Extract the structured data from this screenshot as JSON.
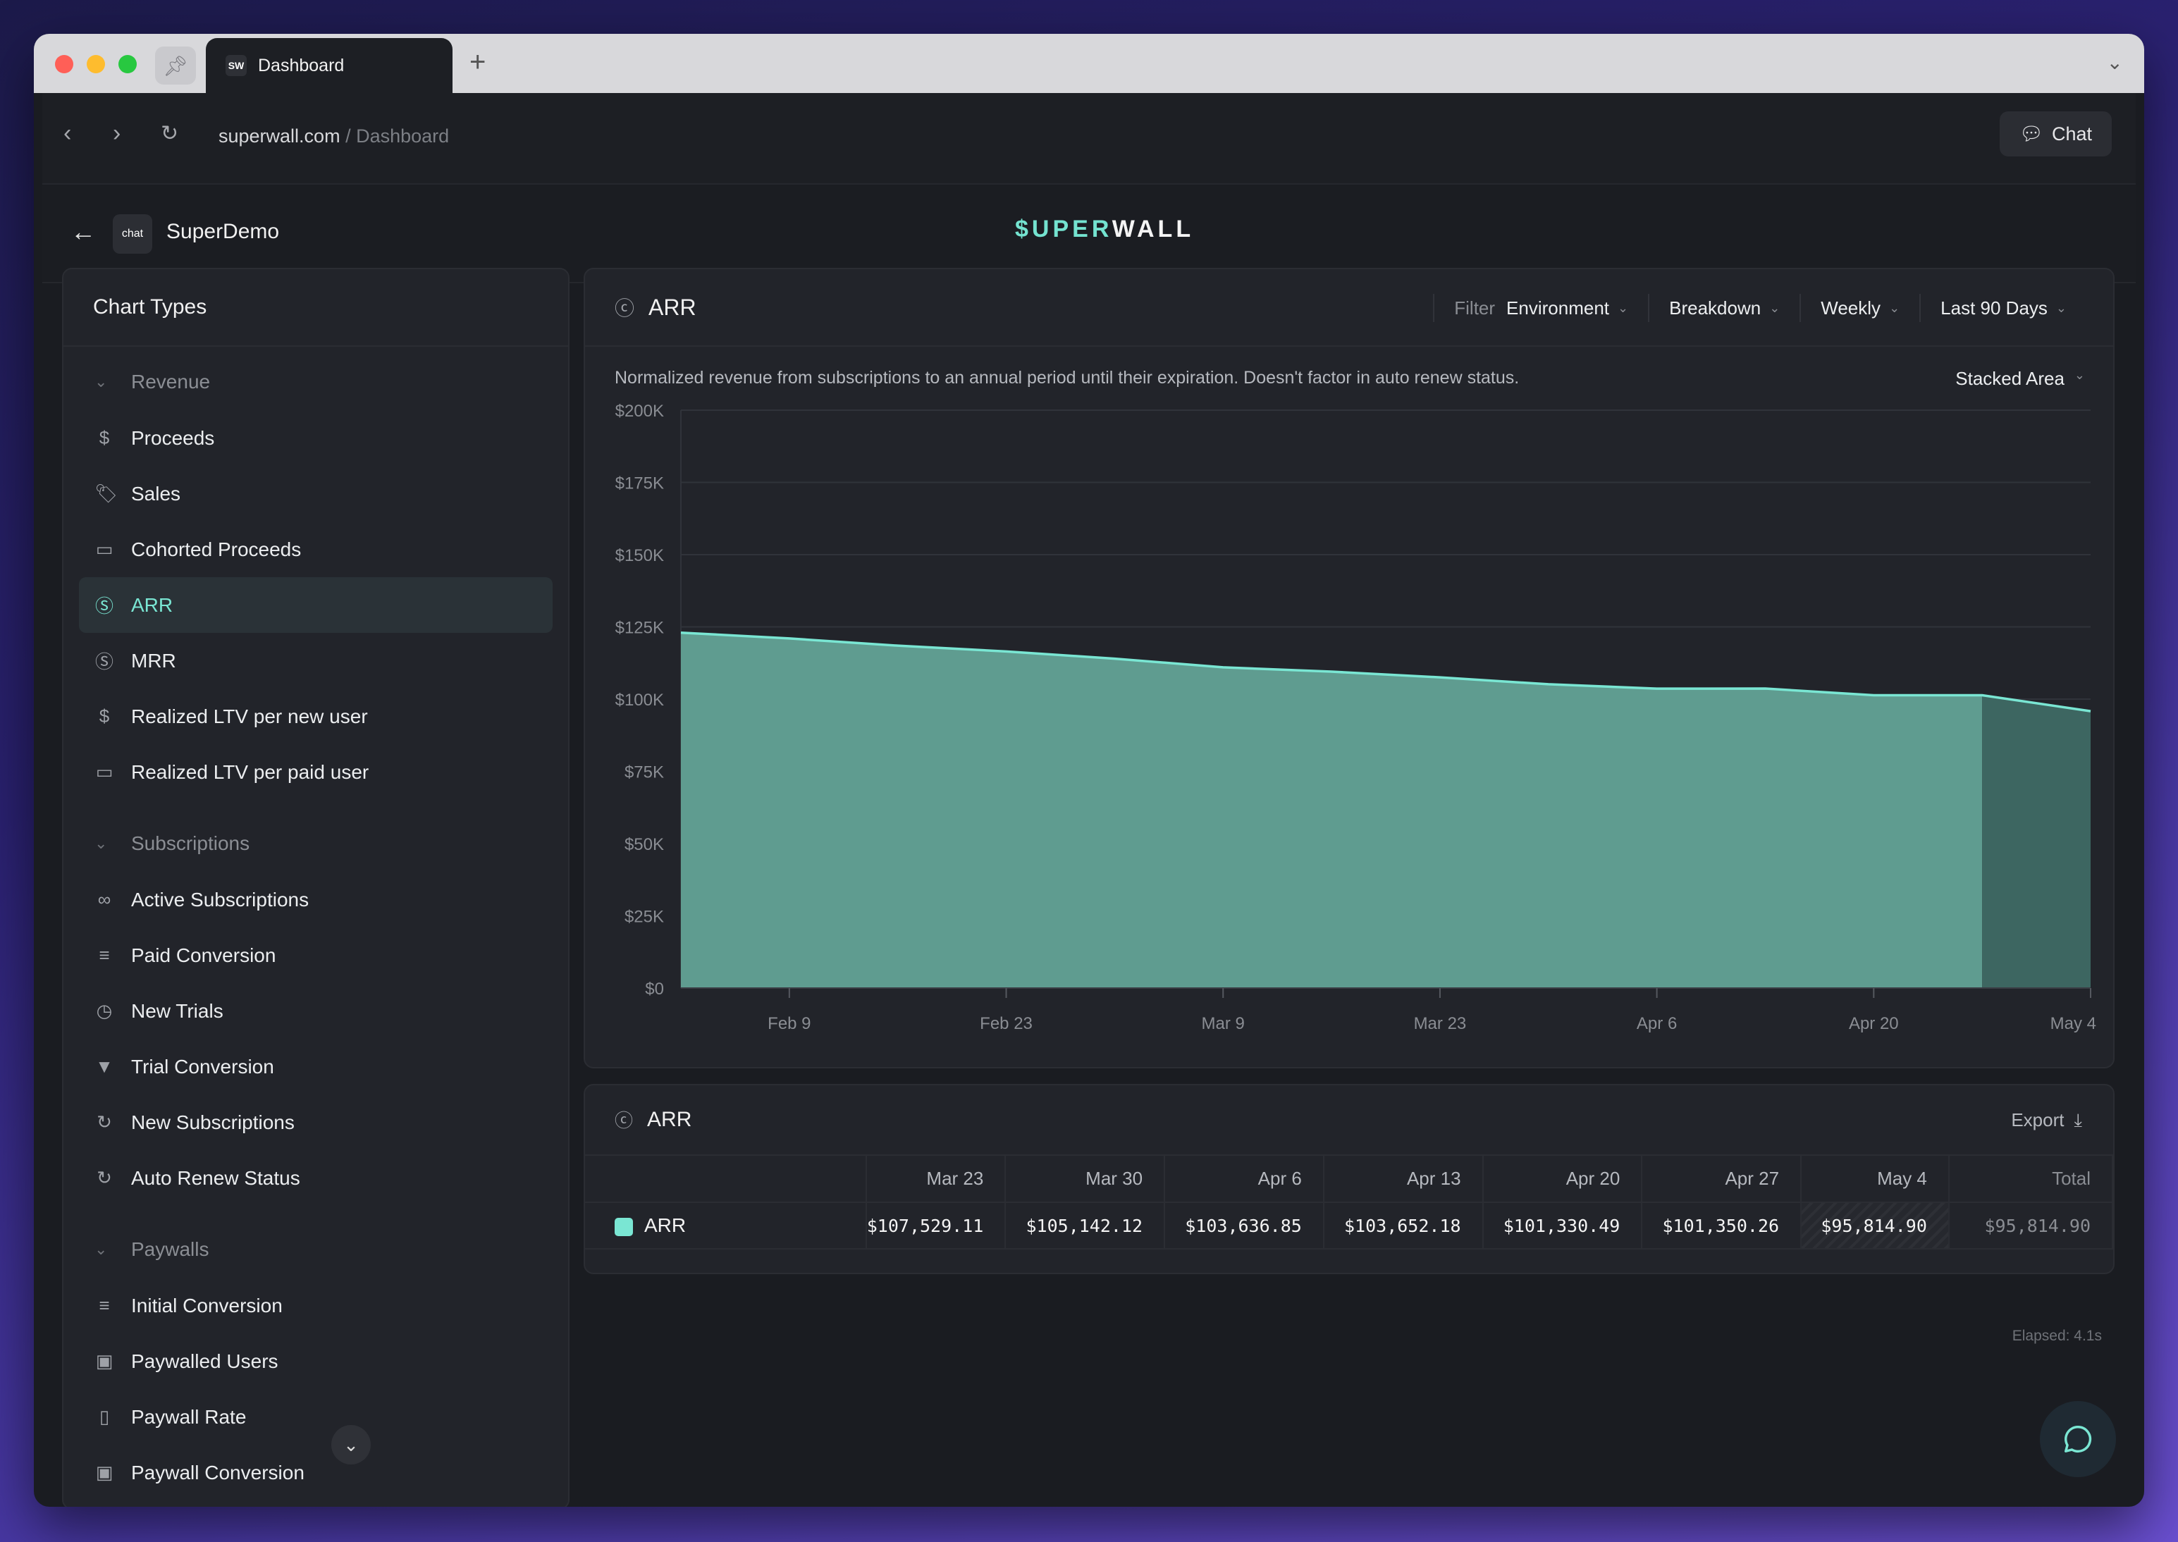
{
  "browser": {
    "tab_title": "Dashboard",
    "tab_favicon": "SW",
    "url_host": "superwall.com",
    "url_path": " / Dashboard",
    "chat_label": "Chat"
  },
  "app": {
    "name": "SuperDemo",
    "logo_text": "chat",
    "brand_prefix": "$",
    "brand_accent": "UPER",
    "brand_rest": "WALL"
  },
  "sidebar": {
    "title": "Chart Types",
    "sections": [
      {
        "label": "Revenue",
        "items": [
          {
            "label": "Proceeds",
            "icon": "dollar-icon"
          },
          {
            "label": "Sales",
            "icon": "tag-icon"
          },
          {
            "label": "Cohorted Proceeds",
            "icon": "calendar-icon"
          },
          {
            "label": "ARR",
            "icon": "cycle-dollar-icon",
            "active": true
          },
          {
            "label": "MRR",
            "icon": "cycle-dollar-icon"
          },
          {
            "label": "Realized LTV per new user",
            "icon": "dollar-icon"
          },
          {
            "label": "Realized LTV per paid user",
            "icon": "calendar-icon"
          }
        ]
      },
      {
        "label": "Subscriptions",
        "items": [
          {
            "label": "Active Subscriptions",
            "icon": "loop-icon"
          },
          {
            "label": "Paid Conversion",
            "icon": "filter-lines-icon"
          },
          {
            "label": "New Trials",
            "icon": "timer-icon"
          },
          {
            "label": "Trial Conversion",
            "icon": "funnel-icon"
          },
          {
            "label": "New Subscriptions",
            "icon": "refresh-icon"
          },
          {
            "label": "Auto Renew Status",
            "icon": "refresh-icon"
          }
        ]
      },
      {
        "label": "Paywalls",
        "items": [
          {
            "label": "Initial Conversion",
            "icon": "filter-lines-icon"
          },
          {
            "label": "Paywalled Users",
            "icon": "user-card-icon"
          },
          {
            "label": "Paywall Rate",
            "icon": "phone-icon"
          },
          {
            "label": "Paywall Conversion",
            "icon": "user-card-icon"
          }
        ]
      }
    ]
  },
  "chart_panel": {
    "title": "ARR",
    "filter_label": "Filter",
    "filter_value": "Environment",
    "breakdown": "Breakdown",
    "interval": "Weekly",
    "range": "Last 90 Days",
    "description": "Normalized revenue from subscriptions to an annual period until their expiration. Doesn't factor in auto renew status.",
    "chart_type_label": "Stacked Area"
  },
  "chart_data": {
    "type": "area",
    "title": "ARR",
    "xlabel": "",
    "ylabel": "",
    "x_ticks": [
      "Feb 9",
      "Feb 23",
      "Mar 9",
      "Mar 23",
      "Apr 6",
      "Apr 20",
      "May 4"
    ],
    "y_ticks": [
      "$0",
      "$25K",
      "$50K",
      "$75K",
      "$100K",
      "$125K",
      "$150K",
      "$175K",
      "$200K"
    ],
    "ylim": [
      0,
      200000
    ],
    "x": [
      "Feb 2",
      "Feb 9",
      "Feb 16",
      "Feb 23",
      "Mar 2",
      "Mar 9",
      "Mar 16",
      "Mar 23",
      "Mar 30",
      "Apr 6",
      "Apr 13",
      "Apr 20",
      "Apr 27",
      "May 4"
    ],
    "series": [
      {
        "name": "ARR",
        "values": [
          123000,
          121000,
          118500,
          116500,
          114000,
          111000,
          109500,
          107529.11,
          105142.12,
          103636.85,
          103652.18,
          101330.49,
          101350.26,
          95814.9
        ],
        "color": "#7ae6d3"
      }
    ],
    "incomplete_last_period": true,
    "grid": true
  },
  "table_panel": {
    "title": "ARR",
    "export_label": "Export",
    "columns": [
      "Mar 23",
      "Mar 30",
      "Apr 6",
      "Apr 13",
      "Apr 20",
      "Apr 27",
      "May 4",
      "Total"
    ],
    "rows": [
      {
        "series": "ARR",
        "values": [
          "$107,529.11",
          "$105,142.12",
          "$103,636.85",
          "$103,652.18",
          "$101,330.49",
          "$101,350.26",
          "$95,814.90",
          "$95,814.90"
        ]
      }
    ]
  },
  "footer": {
    "elapsed": "Elapsed: 4.1s"
  }
}
